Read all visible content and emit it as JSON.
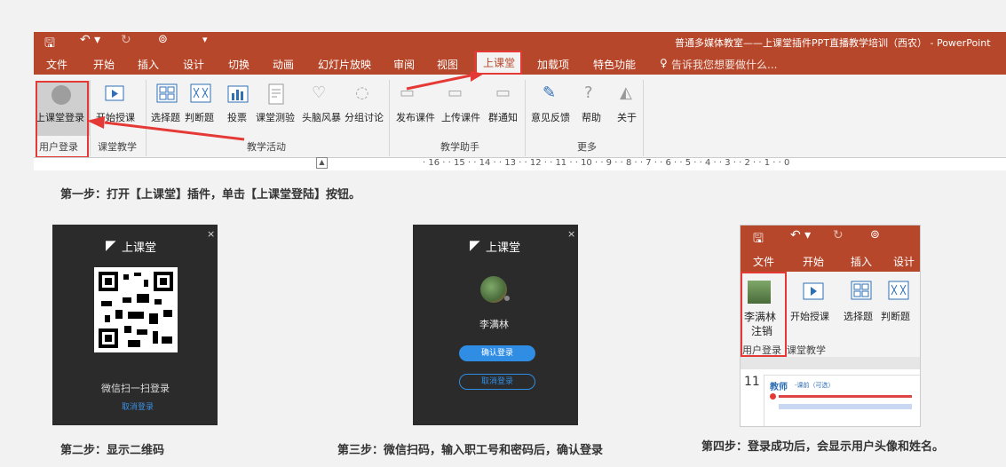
{
  "window": {
    "title": "普通多媒体教室——上课堂插件PPT直播教学培训（西农） - PowerPoint"
  },
  "tabs": [
    "文件",
    "开始",
    "插入",
    "设计",
    "切换",
    "动画",
    "幻灯片放映",
    "审阅",
    "视图",
    "上课堂",
    "加载项",
    "特色功能"
  ],
  "tell_me": "告诉我您想要做什么...",
  "ribbon": {
    "login": "上课堂登录",
    "start": "开始授课",
    "choice": "选择题",
    "judge": "判断题",
    "vote": "投票",
    "quiz": "课堂测验",
    "brainstorm": "头脑风暴",
    "group": "分组讨论",
    "publish": "发布课件",
    "upload": "上传课件",
    "notify": "群通知",
    "feedback": "意见反馈",
    "help": "帮助",
    "about": "关于",
    "groups": [
      "用户登录",
      "课堂教学",
      "教学活动",
      "教学助手",
      "更多"
    ]
  },
  "ruler": "· 16 · · 15 · · 14 · · 13 · · 12 · · 11 · · 10 · · 9 · · 8 · · 7 · · 6 · · 5 · · 4 · · 3 · · 2 · · 1 · · 0",
  "steps": {
    "s1": "第一步：打开【上课堂】插件，单击【上课堂登陆】按钮。",
    "s2": "第二步：显示二维码",
    "s3": "第三步：微信扫码，输入职工号和密码后，确认登录",
    "s4": "第四步：登录成功后，会显示用户头像和姓名。"
  },
  "dialog1": {
    "brand": "上课堂",
    "scan": "微信扫一扫登录",
    "cancel": "取消登录"
  },
  "dialog2": {
    "brand": "上课堂",
    "user": "李满林",
    "confirm": "确认登录",
    "cancel": "取消登录"
  },
  "mini": {
    "tabs": [
      "文件",
      "开始",
      "插入",
      "设计"
    ],
    "user": "李满林",
    "logout": "注销",
    "start": "开始授课",
    "choice": "选择题",
    "judge": "判断题",
    "group1": "用户登录",
    "group2": "课堂教学",
    "slide_no": "11",
    "slide_title": "教师",
    "slide_sub": "-课前（可选）"
  },
  "colors": {
    "accent": "#b7472a",
    "highlight": "#e53935",
    "button": "#2f8de4"
  }
}
